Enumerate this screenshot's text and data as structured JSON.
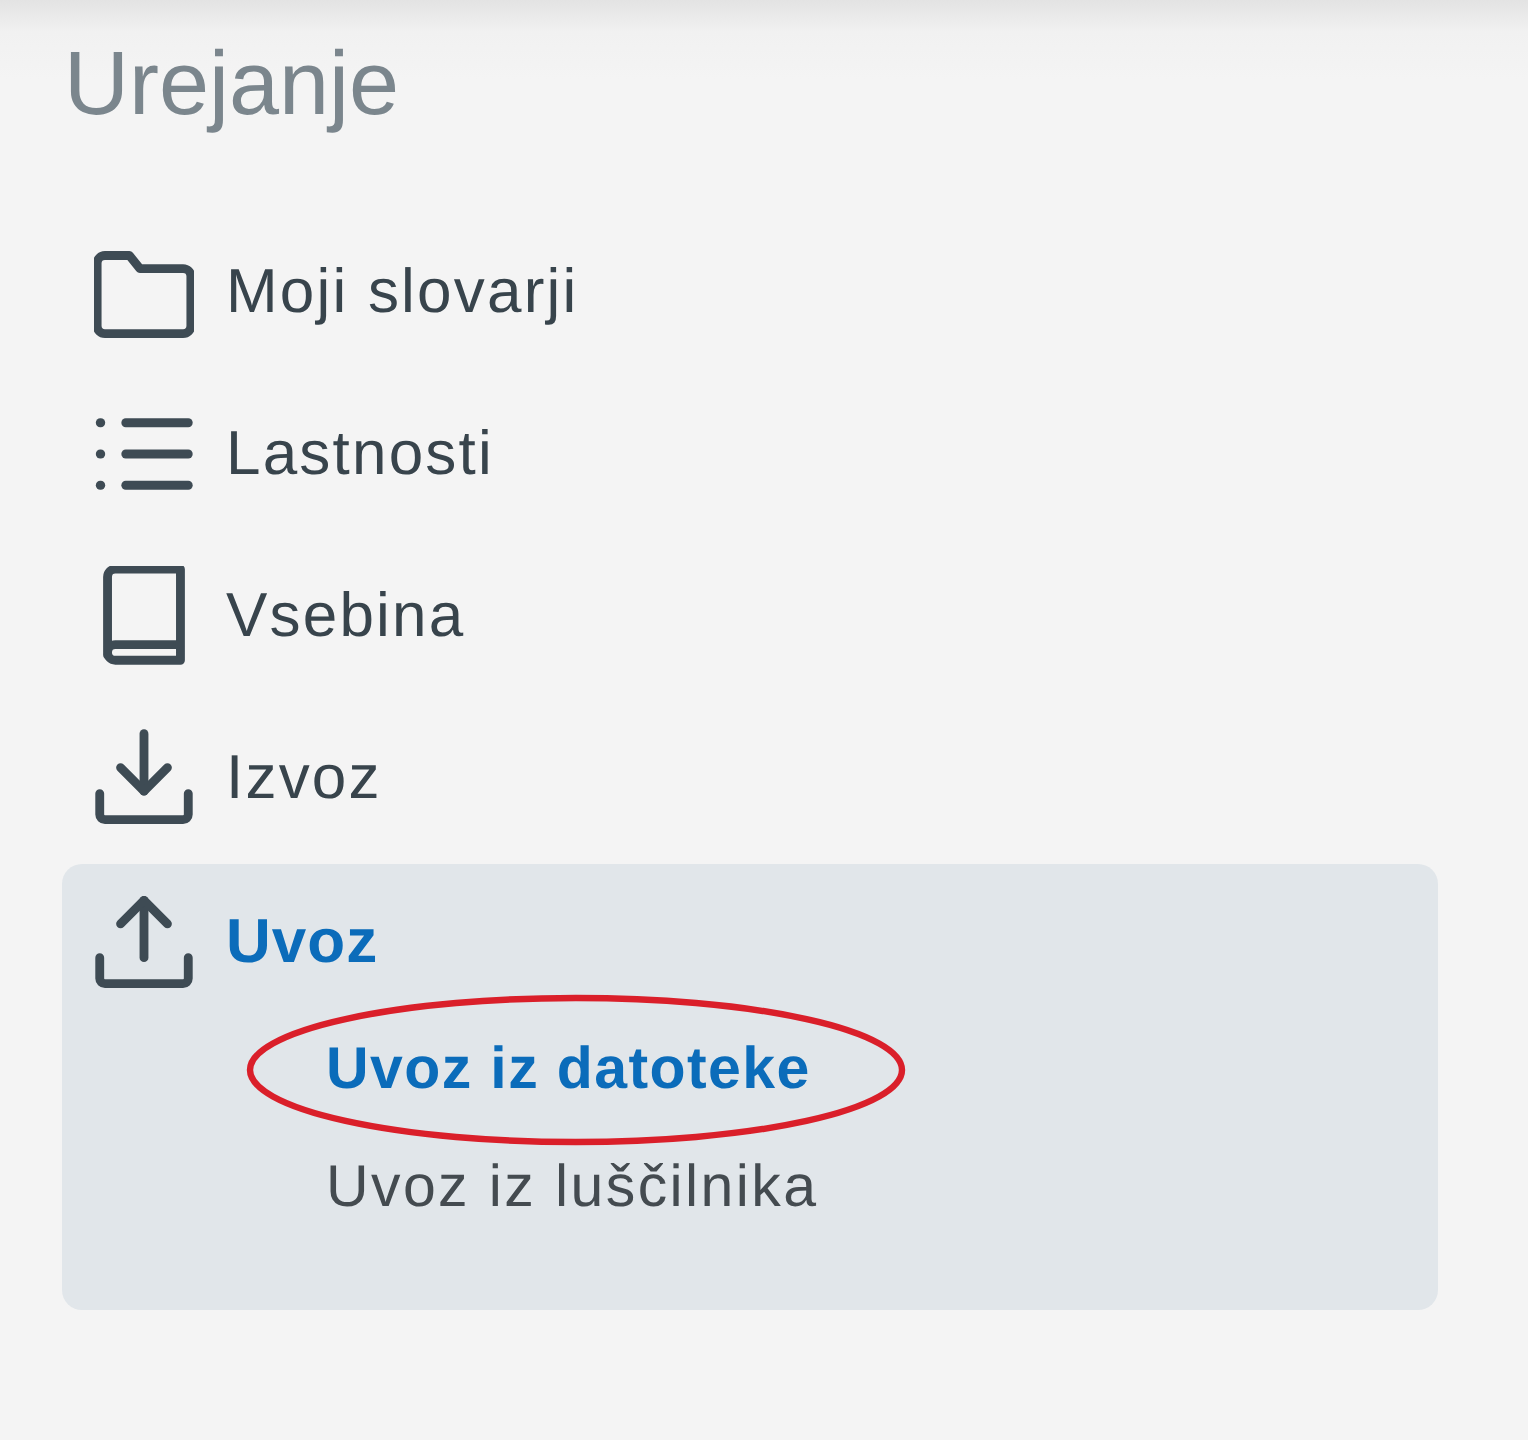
{
  "title": "Urejanje",
  "menu": [
    {
      "label": "Moji slovarji",
      "selected": false
    },
    {
      "label": "Lastnosti",
      "selected": false
    },
    {
      "label": "Vsebina",
      "selected": false
    },
    {
      "label": "Izvoz",
      "selected": false
    },
    {
      "label": "Uvoz",
      "selected": true,
      "expanded": true,
      "children": [
        {
          "label": "Uvoz iz datoteke",
          "selected": true,
          "circled": true
        },
        {
          "label": "Uvoz iz luščilnika",
          "selected": false,
          "circled": false
        }
      ]
    }
  ]
}
